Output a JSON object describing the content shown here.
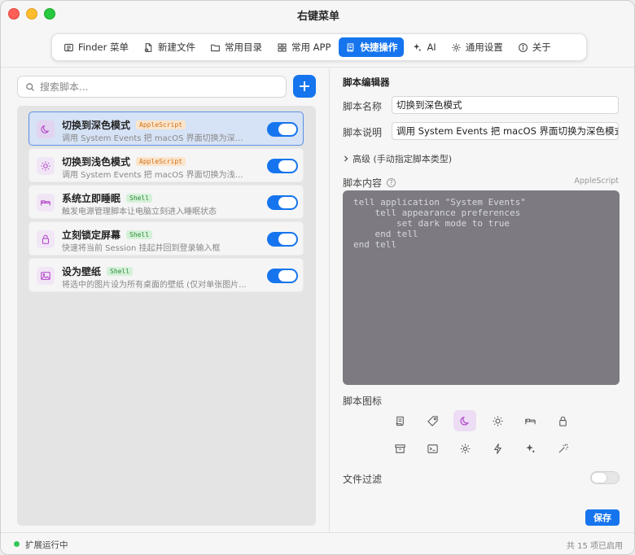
{
  "window": {
    "title": "右键菜单"
  },
  "tabs": [
    {
      "label": "Finder 菜单",
      "icon": "finder-menu-icon"
    },
    {
      "label": "新建文件",
      "icon": "new-file-icon"
    },
    {
      "label": "常用目录",
      "icon": "folder-icon"
    },
    {
      "label": "常用 APP",
      "icon": "apps-grid-icon"
    },
    {
      "label": "快捷操作",
      "icon": "script-icon",
      "active": true
    },
    {
      "label": "AI",
      "icon": "sparkles-icon"
    },
    {
      "label": "通用设置",
      "icon": "gear-icon"
    },
    {
      "label": "关于",
      "icon": "info-icon"
    }
  ],
  "search": {
    "placeholder": "搜索脚本..."
  },
  "scripts": [
    {
      "name": "切换到深色模式",
      "type": "AppleScript",
      "desc": "调用 System Events 把 macOS 界面切换为深色...",
      "icon": "moon-icon",
      "enabled": true,
      "selected": true
    },
    {
      "name": "切换到浅色模式",
      "type": "AppleScript",
      "desc": "调用 System Events 把 macOS 界面切换为浅色...",
      "icon": "sun-icon",
      "enabled": true
    },
    {
      "name": "系统立即睡眠",
      "type": "Shell",
      "desc": "触发电源管理脚本让电脑立刻进入睡眠状态",
      "icon": "bed-icon",
      "enabled": true
    },
    {
      "name": "立刻锁定屏幕",
      "type": "Shell",
      "desc": "快速将当前 Session 挂起并回到登录输入框",
      "icon": "lock-icon",
      "enabled": true
    },
    {
      "name": "设为壁纸",
      "type": "Shell",
      "desc": "将选中的图片设为所有桌面的壁纸 (仅对单张图片...",
      "icon": "image-icon",
      "enabled": true
    }
  ],
  "editor": {
    "section_title": "脚本编辑器",
    "name_label": "脚本名称",
    "name_value": "切换到深色模式",
    "desc_label": "脚本说明",
    "desc_value": "调用 System Events 把 macOS 界面切换为深色模式",
    "advanced_label": "高级 (手动指定脚本类型)",
    "content_label": "脚本内容",
    "help": "?",
    "lang_hint": "AppleScript",
    "code": "tell application \"System Events\"\n    tell appearance preferences\n        set dark mode to true\n    end tell\nend tell",
    "icon_label": "脚本图标",
    "icons": [
      "scroll-icon",
      "tag-icon",
      "moon-icon",
      "sun-icon",
      "bed-icon",
      "lock-icon",
      "archive-icon",
      "terminal-icon",
      "gear-icon",
      "bolt-icon",
      "sparkles-icon",
      "magic-wand-icon"
    ],
    "selected_icon": "moon-icon",
    "filter_label": "文件过滤",
    "filter_enabled": false,
    "save_label": "保存"
  },
  "status": {
    "running_text": "扩展运行中",
    "count_text": "共 15 项已启用"
  },
  "colors": {
    "accent": "#1675ee",
    "status_dot": "#34c759"
  }
}
